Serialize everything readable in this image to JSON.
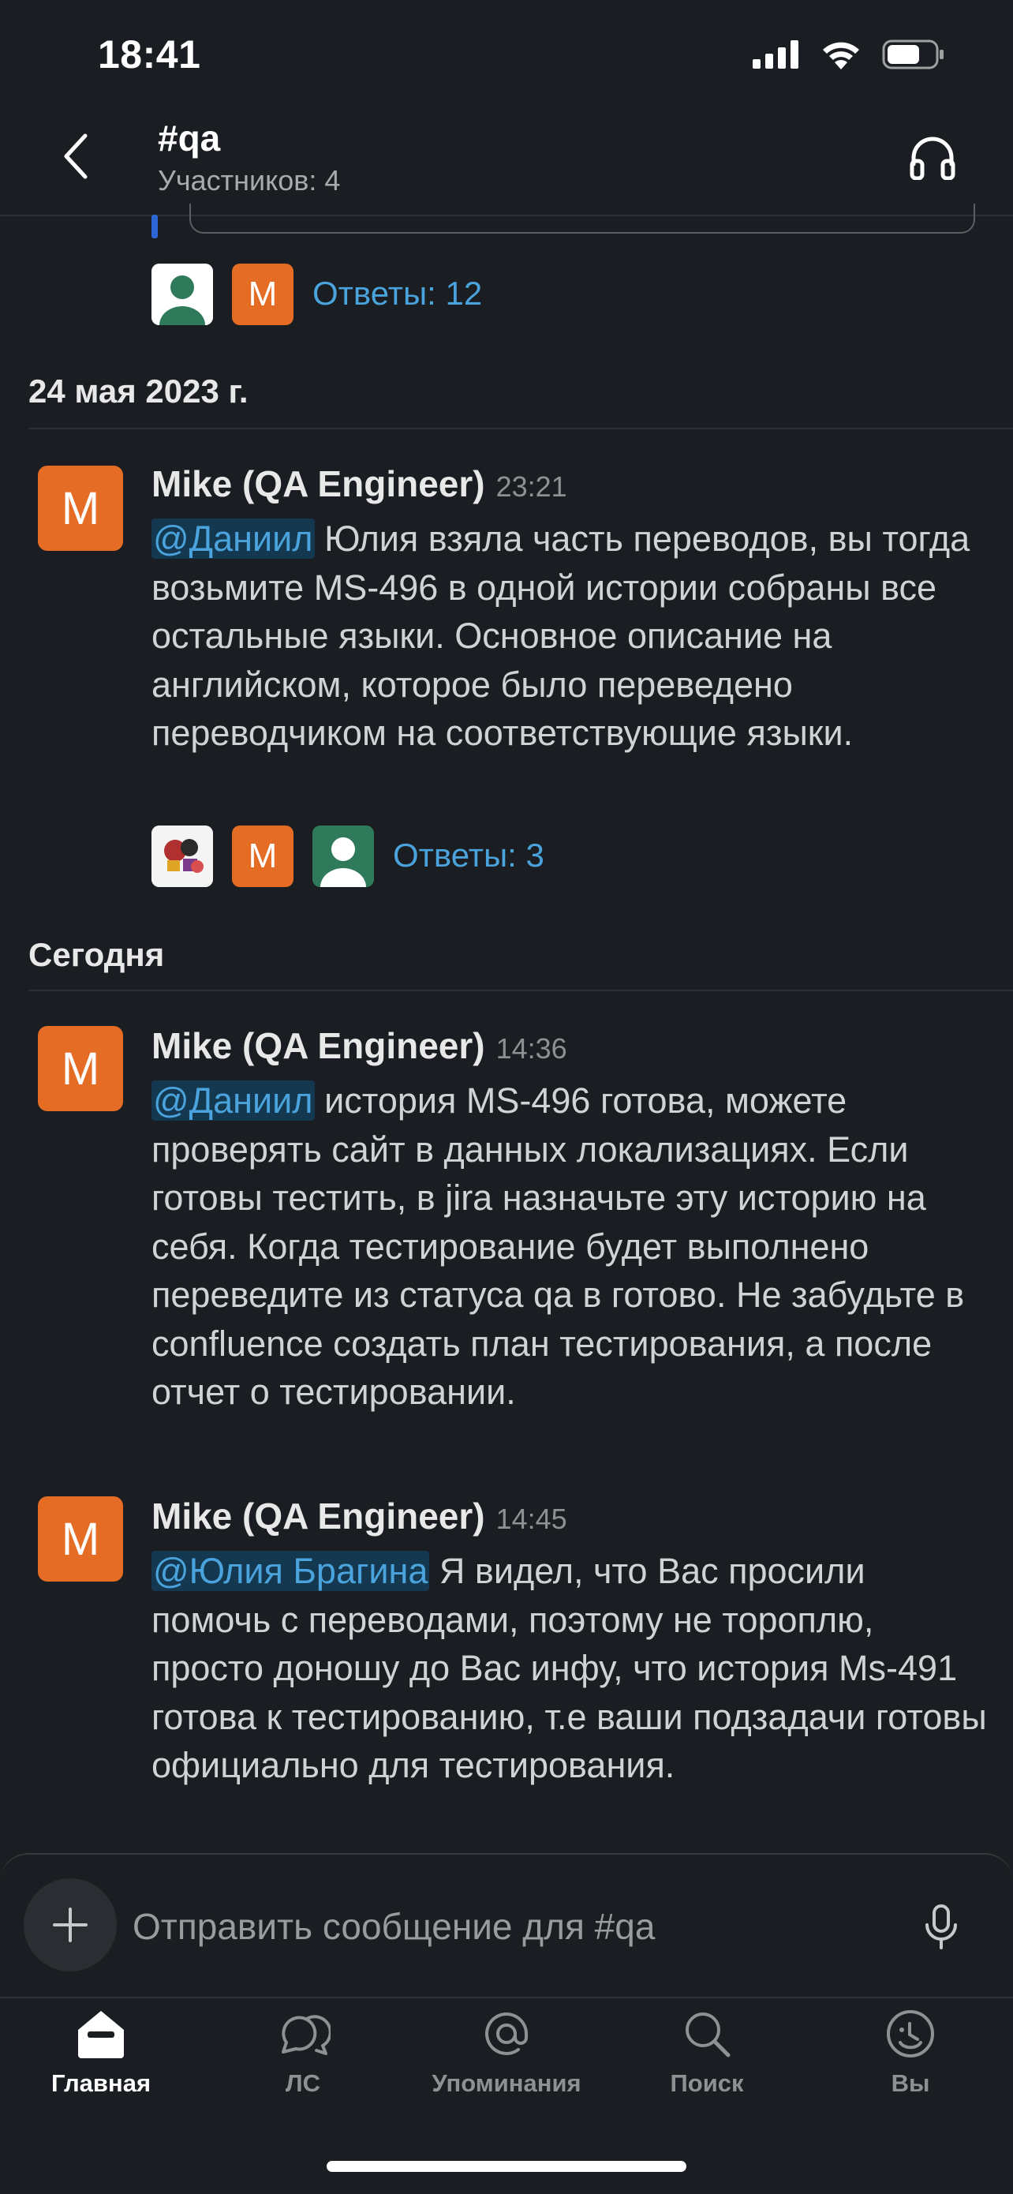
{
  "status_bar": {
    "time": "18:41"
  },
  "header": {
    "channel": "#qa",
    "members": "Участников: 4",
    "headphones_icon": "headphones-icon"
  },
  "prev_thread": {
    "avatar_letter": "M",
    "replies": "Ответы: 12"
  },
  "sections": [
    {
      "date": "24 мая 2023 г."
    },
    {
      "date": "Сегодня"
    }
  ],
  "messages": [
    {
      "avatar_letter": "M",
      "author": "Mike (QA Engineer)",
      "time": "23:21",
      "mention": "@Даниил",
      "text": " Юлия взяла часть переводов, вы тогда возьмите MS-496 в одной истории собраны все остальные языки.  Основное описание на английском, которое было переведено переводчиком на соответствующие языки.",
      "reply_avatar_letter": "M",
      "replies": "Ответы: 3"
    },
    {
      "avatar_letter": "M",
      "author": "Mike (QA Engineer)",
      "time": "14:36",
      "mention": "@Даниил",
      "text": " история MS-496 готова, можете проверять сайт в данных локализациях. Если готовы тестить, в jira назначьте эту историю на себя. Когда тестирование будет выполнено переведите из статуса qa в готово. Не забудьте в confluence создать план тестирования, а после отчет о тестировании."
    },
    {
      "avatar_letter": "M",
      "author": "Mike (QA Engineer)",
      "time": "14:45",
      "mention": "@Юлия Брагина",
      "text": " Я видел, что Вас просили помочь с переводами, поэтому не тороплю, просто доношу до Вас инфу, что история Ms-491 готова к тестированию, т.е ваши подзадачи готовы официально для тестирования."
    }
  ],
  "composer": {
    "placeholder": "Отправить сообщение для #qa"
  },
  "tabs": [
    {
      "label": "Главная",
      "icon": "home-icon",
      "active": true
    },
    {
      "label": "ЛС",
      "icon": "dm-icon"
    },
    {
      "label": "Упоминания",
      "icon": "at-icon"
    },
    {
      "label": "Поиск",
      "icon": "search-icon"
    },
    {
      "label": "Вы",
      "icon": "profile-icon"
    }
  ],
  "colors": {
    "background": "#1a1d21",
    "accent": "#4aa3dc",
    "avatar_orange": "#e46c24",
    "avatar_green": "#2f7a5b"
  }
}
